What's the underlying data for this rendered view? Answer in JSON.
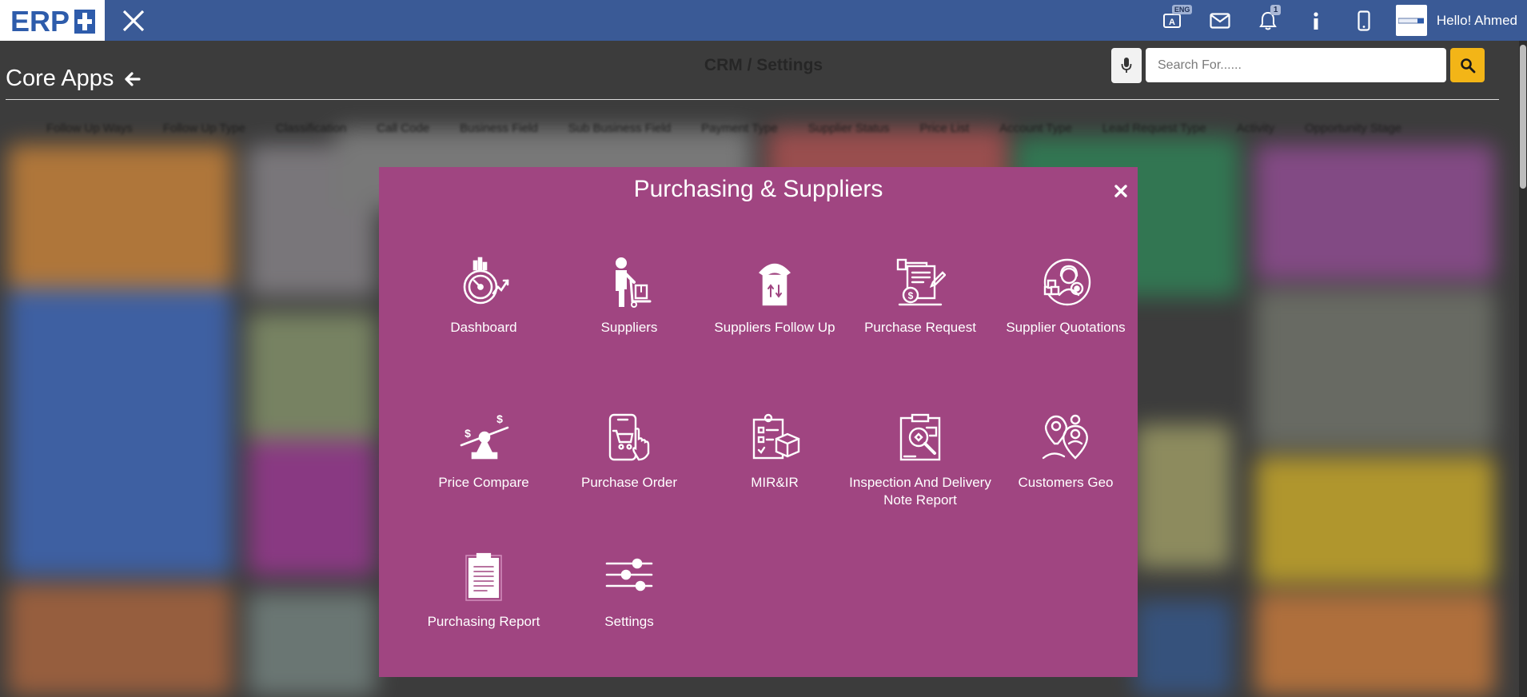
{
  "topbar": {
    "logo_text": "ERP",
    "lang_badge": "ENG",
    "notification_count": "1",
    "user_greeting": "Hello! Ahmed"
  },
  "page": {
    "center_title": "CRM / Settings",
    "section_title": "Core Apps",
    "tabs": [
      "Follow Up Ways",
      "Follow Up Type",
      "Classification",
      "Call Code",
      "Business Field",
      "Sub Business Field",
      "Payment Type",
      "Supplier Status",
      "Price List",
      "Account Type",
      "Lead Request Type",
      "Activity",
      "Opportunity Stage"
    ]
  },
  "search": {
    "placeholder": "Search For......"
  },
  "modal": {
    "title": "Purchasing & Suppliers",
    "items": [
      {
        "label": "Dashboard",
        "icon": "speedometer-icon"
      },
      {
        "label": "Suppliers",
        "icon": "delivery-man-icon"
      },
      {
        "label": "Suppliers Follow Up",
        "icon": "phone-follow-up-icon"
      },
      {
        "label": "Purchase Request",
        "icon": "invoice-request-icon"
      },
      {
        "label": "Supplier Quotations",
        "icon": "supplier-headset-icon"
      },
      {
        "label": "Price Compare",
        "icon": "price-scale-icon"
      },
      {
        "label": "Purchase Order",
        "icon": "mobile-cart-icon"
      },
      {
        "label": "MIR&IR",
        "icon": "checklist-box-icon"
      },
      {
        "label": "Inspection And Delivery Note Report",
        "icon": "inspection-clipboard-icon"
      },
      {
        "label": "Customers Geo",
        "icon": "location-pin-icon"
      },
      {
        "label": "Purchasing Report",
        "icon": "report-document-icon"
      },
      {
        "label": "Settings",
        "icon": "sliders-icon"
      }
    ]
  },
  "colors": {
    "topbar": "#3a5a96",
    "modal": "#a04581",
    "search_button": "#f3b517"
  }
}
